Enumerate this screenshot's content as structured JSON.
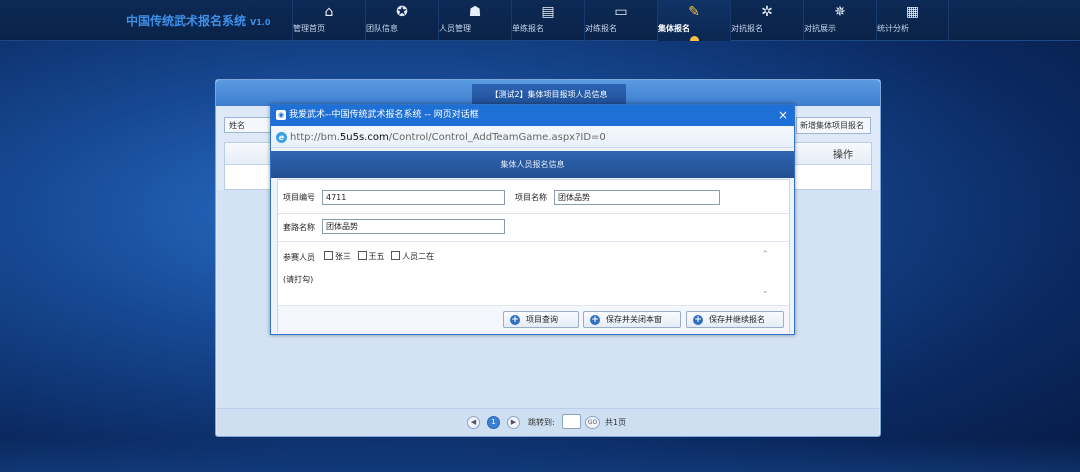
{
  "app": {
    "title": "中国传统武术报名系统",
    "version": "V1.0"
  },
  "nav": {
    "items": [
      {
        "label": "管理首页",
        "icon": "home-icon",
        "glyph": "⌂"
      },
      {
        "label": "团队信息",
        "icon": "gear-icon",
        "glyph": "✪"
      },
      {
        "label": "人员管理",
        "icon": "people-icon",
        "glyph": "☗"
      },
      {
        "label": "单练报名",
        "icon": "document-icon",
        "glyph": "▤"
      },
      {
        "label": "对练报名",
        "icon": "monitor-icon",
        "glyph": "▭"
      },
      {
        "label": "集体报名",
        "icon": "edit-icon",
        "glyph": "✎"
      },
      {
        "label": "对抗报名",
        "icon": "cog-icon",
        "glyph": "✲"
      },
      {
        "label": "对抗展示",
        "icon": "settings-icon",
        "glyph": "✵"
      },
      {
        "label": "统计分析",
        "icon": "grid-icon",
        "glyph": "▦"
      }
    ],
    "active_index": 5
  },
  "panel": {
    "tab_title": "【测试2】集体项目报项人员信息",
    "filter_label": "姓名",
    "add_button": "新增集体项目报名",
    "grid_column_operation": "操作"
  },
  "pager": {
    "prev": "◀",
    "current": "1",
    "next": "▶",
    "goto_label": "跳转到:",
    "go_button": "GO",
    "total": "共1页"
  },
  "dialog": {
    "title": "我爱武术--中国传统武术报名系统 -- 网页对话框",
    "close": "×",
    "url_prefix": "http://bm.",
    "url_host": "5u5s.com",
    "url_path": "/Control/Control_AddTeamGame.aspx?ID=0",
    "section_title": "集体人员报名信息",
    "form": {
      "project_no_label": "项目编号",
      "project_no_value": "4711",
      "project_name_label": "项目名称",
      "project_name_value": "团体品势",
      "routine_label": "套路名称",
      "routine_value": "团体品势",
      "participants_label": "参赛人员",
      "participants": [
        "张三",
        "王五",
        "人员二在"
      ],
      "hint": "(请打勾)"
    },
    "buttons": {
      "query": "项目查询",
      "save_close": "保存并关闭本窗",
      "save_continue": "保存并继续报名"
    }
  },
  "colors": {
    "nav_bg": "#0a2248",
    "accent": "#1e6fd6",
    "active_icon": "#f5c043",
    "brand": "#3f8fe6"
  }
}
